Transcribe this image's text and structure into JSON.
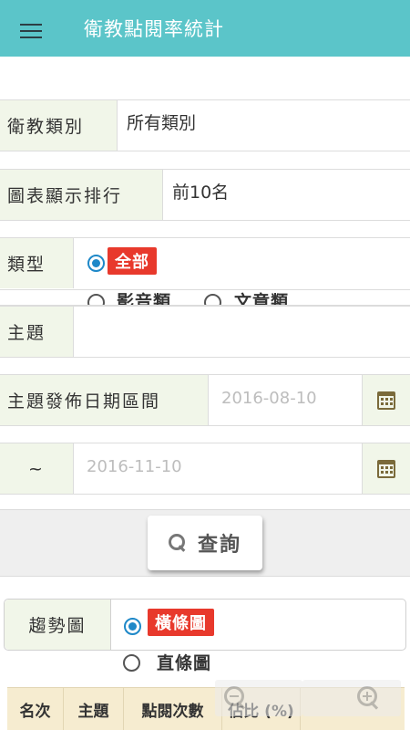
{
  "appbar": {
    "title": "衛教點閱率統計"
  },
  "form": {
    "category": {
      "label": "衛教類別",
      "value": "所有類別"
    },
    "ranking": {
      "label": "圖表顯示排行",
      "value": "前10名"
    },
    "type": {
      "label": "類型",
      "options": [
        "全部",
        "影音類",
        "文章類"
      ],
      "selected": "全部"
    },
    "topic": {
      "label": "主題",
      "value": ""
    },
    "date_from": {
      "label": "主題發佈日期區間",
      "placeholder": "2016-08-10"
    },
    "date_to": {
      "label": "~",
      "placeholder": "2016-11-10"
    }
  },
  "search_button": {
    "label": "查詢"
  },
  "trend": {
    "label": "趨勢圖",
    "options": [
      "橫條圖",
      "直條圖"
    ],
    "selected": "橫條圖"
  },
  "table": {
    "headers": [
      "名次",
      "主題",
      "點閱次數",
      "佔比 (%)"
    ]
  },
  "colors": {
    "accent": "#5bc5c9",
    "badge": "#e8392c",
    "label_bg": "#f1f6e9",
    "table_header": "#f6ecd0"
  }
}
